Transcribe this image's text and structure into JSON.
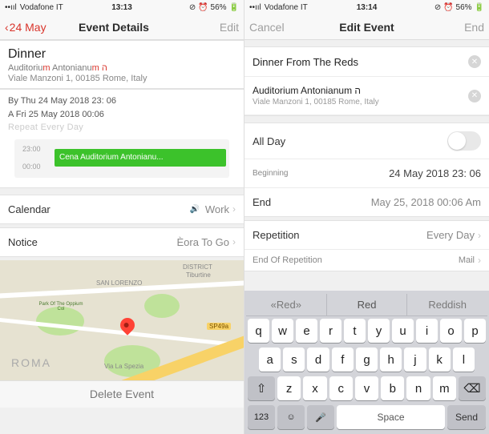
{
  "left": {
    "status": {
      "carrier": "Vodafone IT",
      "time": "13:13",
      "battery": "56%"
    },
    "nav": {
      "back": "24 May",
      "title": "Event Details",
      "action": "Edit"
    },
    "event": {
      "title": "Dinner",
      "location": "Auditorium Antonianum",
      "address": "Viale Manzoni 1, 00185 Rome, Italy"
    },
    "when": {
      "from": "By Thu 24 May 2018 23: 06",
      "to": "A Fri 25 May 2018 00:06",
      "repeat": "Repeat Every Day"
    },
    "timeline": {
      "t1": "23:00",
      "t2": "00:00",
      "slot": "Cena Auditorium Antonianu..."
    },
    "rows": {
      "calendar_lbl": "Calendar",
      "calendar_val": "Work",
      "notice_lbl": "Notice",
      "notice_val": "Èora To Go"
    },
    "map": {
      "city": "ROMA",
      "n1": "SAN LORENZO",
      "n2": "DISTRICT",
      "n3": "Tiburtine",
      "road1": "SP49a",
      "road2": "Via La Spezia",
      "park": "Park Of The Oppium Col"
    },
    "delete": "Delete Event"
  },
  "right": {
    "status": {
      "carrier": "Vodafone IT",
      "time": "13:14",
      "battery": "56%"
    },
    "nav": {
      "cancel": "Cancel",
      "title": "Edit Event",
      "action": "End"
    },
    "inputs": {
      "title": "Dinner From The Reds",
      "location": "Auditorium Antonianum ה",
      "address": "Viale Manzoni 1, 00185 Rome, Italy"
    },
    "rows": {
      "allday": "All Day",
      "begin_lbl": "Beginning",
      "begin_val": "24 May 2018 23: 06",
      "end_lbl": "End",
      "end_val": "May 25, 2018 00:06 Am",
      "rep_lbl": "Repetition",
      "rep_val": "Every Day",
      "repend_lbl": "End Of Repetition",
      "repend_val": "Mail"
    },
    "kbd": {
      "sugg": [
        "«Red»",
        "Red",
        "Reddish"
      ],
      "r1": [
        "q",
        "w",
        "e",
        "r",
        "t",
        "y",
        "u",
        "i",
        "o",
        "p"
      ],
      "r2": [
        "a",
        "s",
        "d",
        "f",
        "g",
        "h",
        "j",
        "k",
        "l"
      ],
      "r3": [
        "z",
        "x",
        "c",
        "v",
        "b",
        "n",
        "m"
      ],
      "num": "123",
      "space": "Space",
      "send": "Send"
    }
  }
}
